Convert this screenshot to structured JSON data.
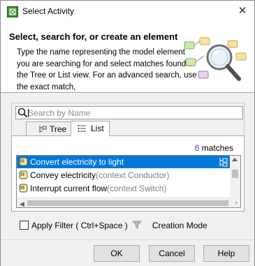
{
  "window": {
    "title": "Select Activity",
    "close_glyph": "✕"
  },
  "banner": {
    "title": "Select, search for, or create an element",
    "description": "Type the name representing the model element you are searching for and select matches found in the Tree or List view. For an advanced search, use the exact match,"
  },
  "search": {
    "placeholder": "Search by Name",
    "value": ""
  },
  "tabs": [
    {
      "label": "Tree",
      "icon": "tree-icon",
      "selected": false
    },
    {
      "label": "List",
      "icon": "list-icon",
      "selected": true
    }
  ],
  "matches": {
    "count": "6",
    "suffix": " matches"
  },
  "results": [
    {
      "name": "Convert electricity to light",
      "context": "",
      "selected": true
    },
    {
      "name": "Convey electricity",
      "context": "(context Conductor)",
      "selected": false
    },
    {
      "name": "Interrupt current flow",
      "context": "(context Switch)",
      "selected": false
    }
  ],
  "filter": {
    "apply_label": "Apply Filter ( Ctrl+Space )",
    "creation_mode_label": "Creation Mode",
    "checked": false
  },
  "buttons": {
    "ok": "OK",
    "cancel": "Cancel",
    "help": "Help"
  },
  "colors": {
    "selection": "#0078d7",
    "match_count": "#1f4fbf",
    "context_text": "#808080"
  }
}
